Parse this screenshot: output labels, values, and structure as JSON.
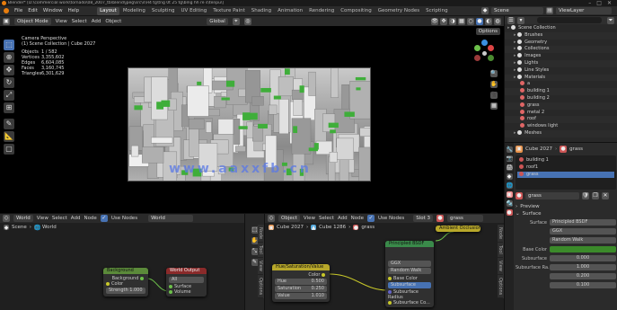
{
  "titlebar": {
    "title": "Blender* [D:\\commercial work\\tornado\\08_2007_tb\\blend\\jpeg\\src\\s\\H4 tg\\tng 0t 25 tg\\blng hh re s\\tenpu\\]"
  },
  "menubar": {
    "items": [
      "File",
      "Edit",
      "Window",
      "Help"
    ],
    "workspaces": [
      "Layout",
      "Modeling",
      "Sculpting",
      "UV Editing",
      "Texture Paint",
      "Shading",
      "Animation",
      "Rendering",
      "Compositing",
      "Geometry Nodes",
      "Scripting"
    ],
    "active_workspace": "Layout",
    "scene": "Scene",
    "view_layer": "ViewLayer"
  },
  "viewport_header": {
    "mode": "Object Mode",
    "menus": [
      "View",
      "Select",
      "Add",
      "Object"
    ],
    "orientation": "Global",
    "options": "Options"
  },
  "viewport_info": {
    "view": "Camera Perspective",
    "collection": "(1) Scene Collection | Cube 2027",
    "stats": [
      {
        "label": "Objects",
        "value": "1 / 582"
      },
      {
        "label": "Vertices",
        "value": "3,355,602"
      },
      {
        "label": "Edges",
        "value": "6,604,085"
      },
      {
        "label": "Faces",
        "value": "3,160,745"
      },
      {
        "label": "Triangles",
        "value": "6,301,629"
      }
    ]
  },
  "watermark": "www.aaxxfb.cn",
  "outliner": {
    "rows": [
      {
        "depth": 0,
        "label": "Scene Collection",
        "color": "#dddddd"
      },
      {
        "depth": 1,
        "label": "Brushes",
        "color": "#dddddd"
      },
      {
        "depth": 1,
        "label": "Geometry",
        "color": "#dddddd"
      },
      {
        "depth": 1,
        "label": "Collections",
        "color": "#dddddd"
      },
      {
        "depth": 1,
        "label": "Images",
        "color": "#dddddd"
      },
      {
        "depth": 1,
        "label": "Lights",
        "color": "#dddddd"
      },
      {
        "depth": 1,
        "label": "Line Styles",
        "color": "#dddddd"
      },
      {
        "depth": 1,
        "label": "Materials",
        "color": "#dddddd"
      },
      {
        "depth": 2,
        "label": "a",
        "color": "#e06666"
      },
      {
        "depth": 2,
        "label": "building 1",
        "color": "#e06666"
      },
      {
        "depth": 2,
        "label": "building 2",
        "color": "#e06666"
      },
      {
        "depth": 2,
        "label": "grass",
        "color": "#e06666"
      },
      {
        "depth": 2,
        "label": "metal 2",
        "color": "#e06666"
      },
      {
        "depth": 2,
        "label": "roof",
        "color": "#e06666"
      },
      {
        "depth": 2,
        "label": "windows light",
        "color": "#e06666"
      },
      {
        "depth": 1,
        "label": "Meshes",
        "color": "#dddddd"
      }
    ]
  },
  "properties": {
    "object": "Cube 2027",
    "material": "grass",
    "slots": [
      "building 1",
      "roof1",
      "grass"
    ],
    "material_field": "grass",
    "preview": "Preview",
    "surface_section": "Surface",
    "surface": {
      "label": "Surface",
      "value": "Principled BSDF"
    },
    "distribution": "GGX",
    "subsurface_method": "Random Walk",
    "fields": [
      {
        "label": "Base Color",
        "value": ""
      },
      {
        "label": "Subsurface",
        "value": "0.000"
      },
      {
        "label": "Subsurface Ra...",
        "value": "1.000"
      },
      {
        "label": "",
        "value": "0.200"
      },
      {
        "label": "",
        "value": "0.100"
      }
    ]
  },
  "node_editor_left": {
    "header": {
      "editor": "World",
      "menus": [
        "View",
        "Select",
        "Add",
        "Node"
      ],
      "use_nodes": "Use Nodes",
      "datablock": "World"
    },
    "breadcrumb": [
      "Scene",
      "World"
    ],
    "nodes": [
      {
        "title": "Background",
        "rows": [
          "Color",
          "Strength 1.000"
        ],
        "out": "Background"
      },
      {
        "title": "World Output",
        "rows": [
          "All",
          "Surface",
          "Volume"
        ]
      }
    ]
  },
  "node_editor_right": {
    "header": {
      "editor": "Object",
      "menus": [
        "View",
        "Select",
        "Add",
        "Node"
      ],
      "use_nodes": "Use Nodes",
      "slot": "Slot 3",
      "material": "grass"
    },
    "breadcrumb": [
      "Cube 2027",
      "Cube 1286",
      "grass"
    ],
    "nodes": [
      {
        "title": "Hue/Saturation/Value",
        "out": "Color",
        "rows": [
          {
            "label": "Hue",
            "value": "0.500"
          },
          {
            "label": "Saturation",
            "value": "0.250"
          },
          {
            "label": "Value",
            "value": "1.010"
          }
        ]
      },
      {
        "title": "Principled BSDF",
        "rows": [
          "GGX",
          "Random Walk",
          "Base Color",
          "Subsurface",
          "Subsurface Radius",
          "Subsurface Co..."
        ]
      },
      {
        "title": "Ambient Occlusion",
        "rows": []
      }
    ],
    "side_tabs": [
      "Node",
      "Tool",
      "View",
      "Options"
    ]
  },
  "mid_side_tabs": [
    "Node",
    "Tool",
    "View",
    "Options"
  ]
}
